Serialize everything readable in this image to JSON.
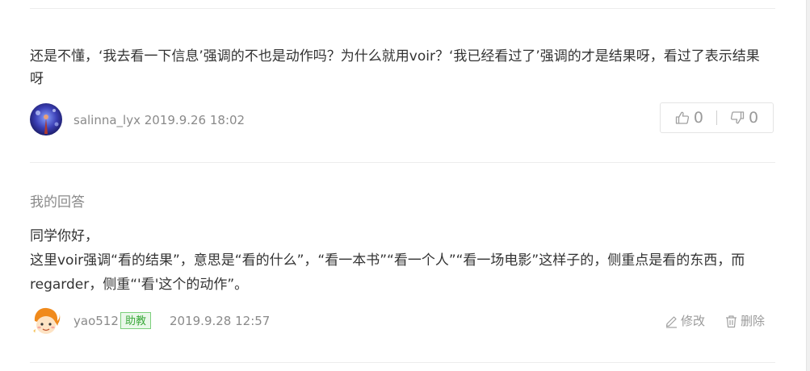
{
  "comment": {
    "text": "还是不懂，‘我去看一下信息’强调的不也是动作吗？为什么就用voir？‘我已经看过了’强调的才是结果呀，看过了表示结果呀",
    "username": "salinna_lyx",
    "timestamp": "2019.9.26 18:02",
    "likes": "0",
    "dislikes": "0"
  },
  "answer": {
    "section_title": "我的回答",
    "greeting": "同学你好，",
    "body": "这里voir强调“看的结果”，意思是“看的什么”，“看一本书”“看一个人”“看一场电影”这样子的，侧重点是看的东西，而regarder，侧重“'看'这个的动作”。",
    "username": "yao512",
    "role_badge": "助教",
    "timestamp": "2019.9.28 12:57",
    "edit_label": "修改",
    "delete_label": "删除"
  },
  "colors": {
    "text": "#333333",
    "meta": "#8a8a8a",
    "badge_border": "#7ccf7c",
    "badge_text": "#3aa83a",
    "badge_bg": "#eaf8ea"
  }
}
